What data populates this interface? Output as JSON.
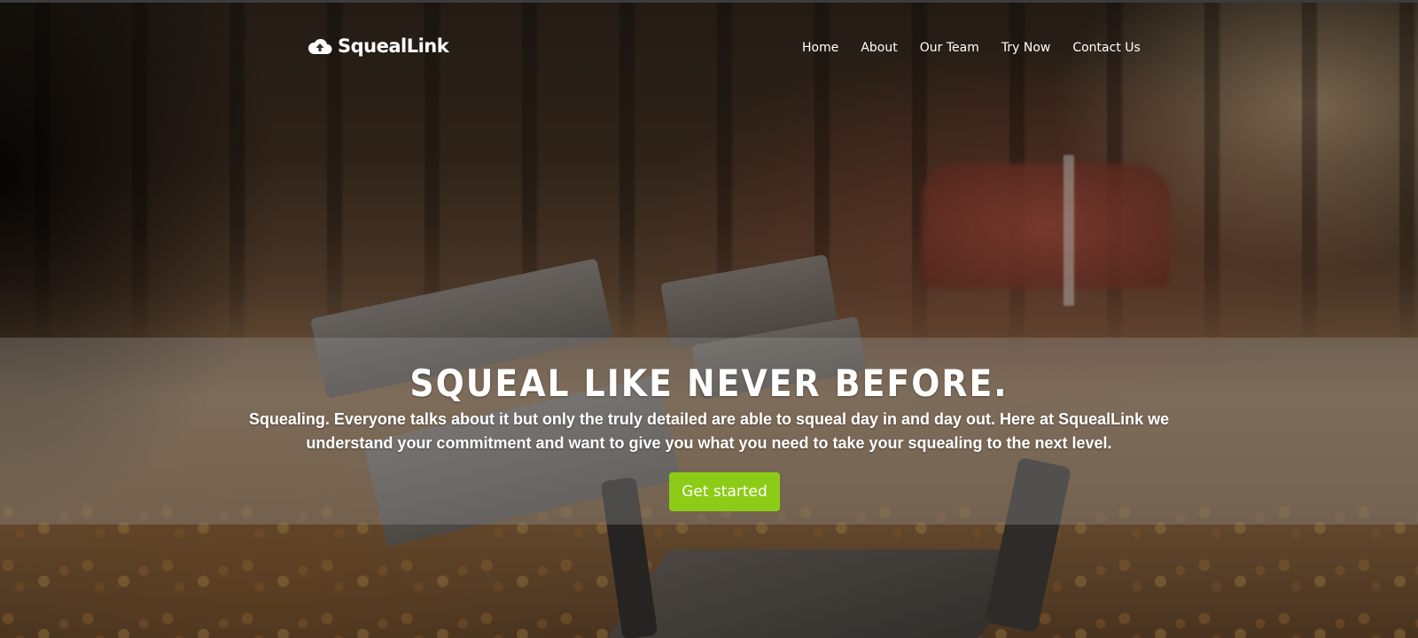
{
  "brand": {
    "name": "SquealLink",
    "icon": "cloud-upload-icon"
  },
  "nav": {
    "items": [
      {
        "label": "Home"
      },
      {
        "label": "About"
      },
      {
        "label": "Our Team"
      },
      {
        "label": "Try Now"
      },
      {
        "label": "Contact Us"
      }
    ]
  },
  "hero": {
    "headline": "SQUEAL LIKE NEVER BEFORE.",
    "subtext": "Squealing. Everyone talks about it but only the truly detailed are able to squeal day in and day out. Here at SquealLink we understand your commitment and want to give you what you need to take your squealing to the next level.",
    "cta_label": "Get started"
  },
  "colors": {
    "cta": "#8ccc16",
    "text": "#ffffff",
    "band_overlay": "rgba(150,150,150,0.35)"
  }
}
